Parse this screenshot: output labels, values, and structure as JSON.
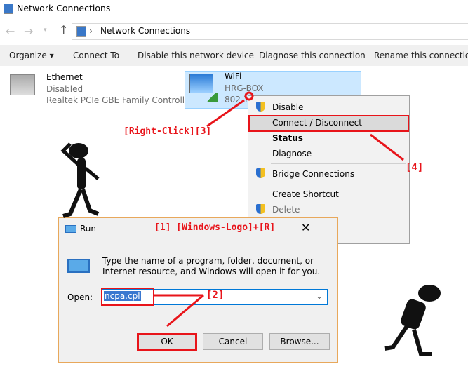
{
  "window": {
    "title": "Network Connections"
  },
  "address": {
    "path": "Network Connections",
    "sep": "›"
  },
  "toolbar": {
    "organize": "Organize ▾",
    "connect_to": "Connect To",
    "disable": "Disable this network device",
    "diagnose": "Diagnose this connection",
    "rename": "Rename this connection"
  },
  "connections": [
    {
      "name": "Ethernet",
      "status": "Disabled",
      "device": "Realtek PCIe GBE Family Controller"
    },
    {
      "name": "WiFi",
      "status": "HRG-BOX",
      "device": "802.1"
    }
  ],
  "context_menu": {
    "items": [
      "Disable",
      "Connect / Disconnect",
      "Status",
      "Diagnose",
      "Bridge Connections",
      "Create Shortcut",
      "Delete"
    ]
  },
  "run": {
    "title": "Run",
    "description": "Type the name of a program, folder, document, or Internet resource, and Windows will open it for you.",
    "open_label": "Open:",
    "open_value": "ncpa.cpl",
    "ok": "OK",
    "cancel": "Cancel",
    "browse": "Browse..."
  },
  "annotations": {
    "step1": "[1] [Windows-Logo]+[R]",
    "step2": "[2]",
    "step3": "[Right-Click][3]",
    "step4": "[4]"
  },
  "colors": {
    "annotation": "#e8141a",
    "selection": "#cce8ff"
  }
}
